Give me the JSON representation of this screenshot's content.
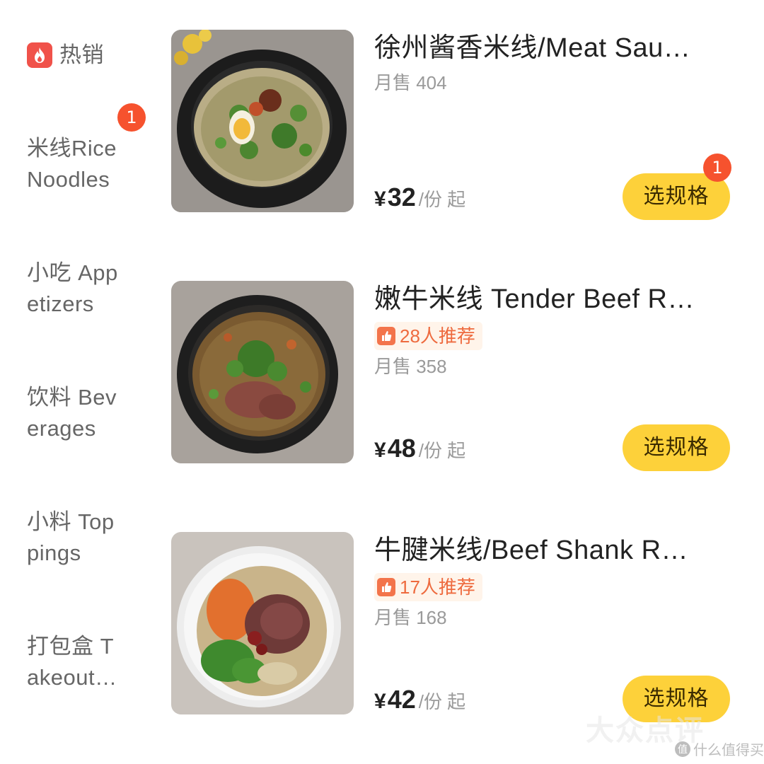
{
  "sidebar": {
    "items": [
      {
        "lines": [
          "热销"
        ],
        "icon": "flame-icon"
      },
      {
        "lines": [
          "米线Rice",
          "Noodles"
        ],
        "badge": "1"
      },
      {
        "lines": [
          "小吃 App",
          "etizers"
        ]
      },
      {
        "lines": [
          "饮料 Bev",
          "erages"
        ]
      },
      {
        "lines": [
          "小料 Top",
          "pings"
        ]
      },
      {
        "lines": [
          "打包盒 T",
          "akeout…"
        ]
      }
    ]
  },
  "products": [
    {
      "title": "徐州酱香米线/Meat Sau…",
      "sales_label": "月售 404",
      "currency": "¥",
      "price": "32",
      "unit": "/份 起",
      "button_label": "选规格",
      "cart_badge": "1"
    },
    {
      "title": "嫩牛米线 Tender Beef R…",
      "recommend": "28人推荐",
      "sales_label": "月售 358",
      "currency": "¥",
      "price": "48",
      "unit": "/份 起",
      "button_label": "选规格"
    },
    {
      "title": "牛腱米线/Beef Shank R…",
      "recommend": "17人推荐",
      "sales_label": "月售 168",
      "currency": "¥",
      "price": "42",
      "unit": "/份 起",
      "button_label": "选规格"
    }
  ],
  "watermark": {
    "main": "大众点评",
    "sub": "什么值得买",
    "sub_badge": "值"
  },
  "colors": {
    "accent_yellow": "#fdd13a",
    "badge_red": "#f6522e",
    "hot_red": "#f0524a",
    "recommend_orange": "#ee6a3e"
  }
}
